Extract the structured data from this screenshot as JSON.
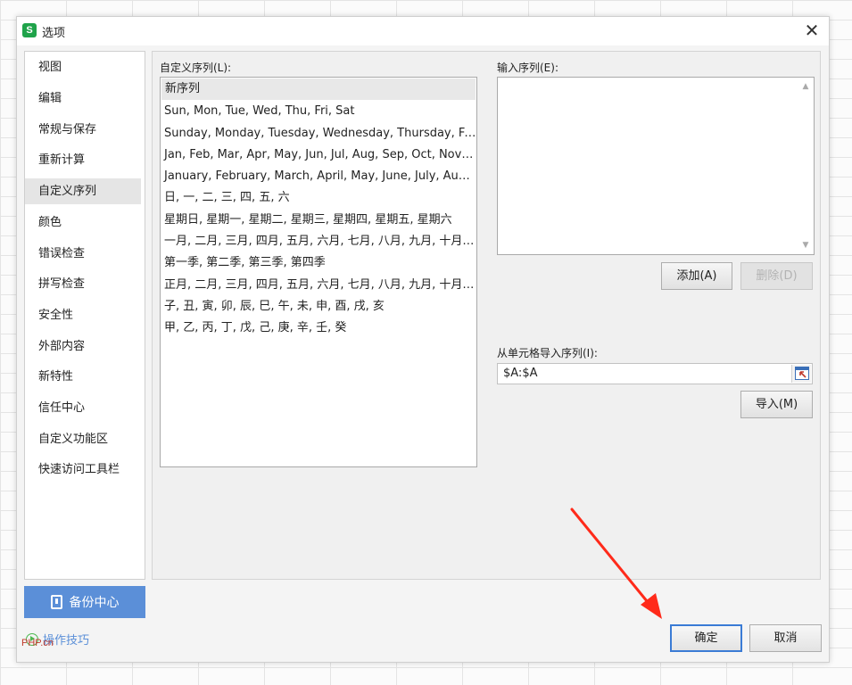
{
  "window": {
    "title": "选项",
    "app_icon_letter": "S",
    "close_glyph": "✕"
  },
  "nav": {
    "items": [
      {
        "label": "视图"
      },
      {
        "label": "编辑"
      },
      {
        "label": "常规与保存"
      },
      {
        "label": "重新计算"
      },
      {
        "label": "自定义序列",
        "selected": true
      },
      {
        "label": "颜色"
      },
      {
        "label": "错误检查"
      },
      {
        "label": "拼写检查"
      },
      {
        "label": "安全性"
      },
      {
        "label": "外部内容"
      },
      {
        "label": "新特性"
      },
      {
        "label": "信任中心"
      },
      {
        "label": "自定义功能区"
      },
      {
        "label": "快速访问工具栏"
      }
    ],
    "backup_label": "备份中心",
    "tips_label": "操作技巧"
  },
  "custom_lists": {
    "label": "自定义序列(L):",
    "items": [
      "新序列",
      "Sun, Mon, Tue, Wed, Thu, Fri, Sat",
      "Sunday, Monday, Tuesday, Wednesday, Thursday, Friday, Saturday",
      "Jan, Feb, Mar, Apr, May, Jun, Jul, Aug, Sep, Oct, Nov, Dec",
      "January, February, March, April, May, June, July, August, September, October, November, December",
      "日, 一, 二, 三, 四, 五, 六",
      "星期日, 星期一, 星期二, 星期三, 星期四, 星期五, 星期六",
      "一月, 二月, 三月, 四月, 五月, 六月, 七月, 八月, 九月, 十月, 十一月, 十二月",
      "第一季, 第二季, 第三季, 第四季",
      "正月, 二月, 三月, 四月, 五月, 六月, 七月, 八月, 九月, 十月, 十一月, 腊月",
      "子, 丑, 寅, 卯, 辰, 巳, 午, 未, 申, 酉, 戌, 亥",
      "甲, 乙, 丙, 丁, 戊, 己, 庚, 辛, 壬, 癸"
    ]
  },
  "entries": {
    "label": "输入序列(E):",
    "value": ""
  },
  "buttons": {
    "add": "添加(A)",
    "delete": "删除(D)",
    "import": "导入(M)",
    "ok": "确定",
    "cancel": "取消"
  },
  "import_cells": {
    "label": "从单元格导入序列(I):",
    "value": "$A:$A"
  },
  "watermark": "PHP.cn",
  "colors": {
    "accent": "#5b8fd8",
    "arrow": "#ff2a1a",
    "tips_icon": "#4cb84f"
  }
}
